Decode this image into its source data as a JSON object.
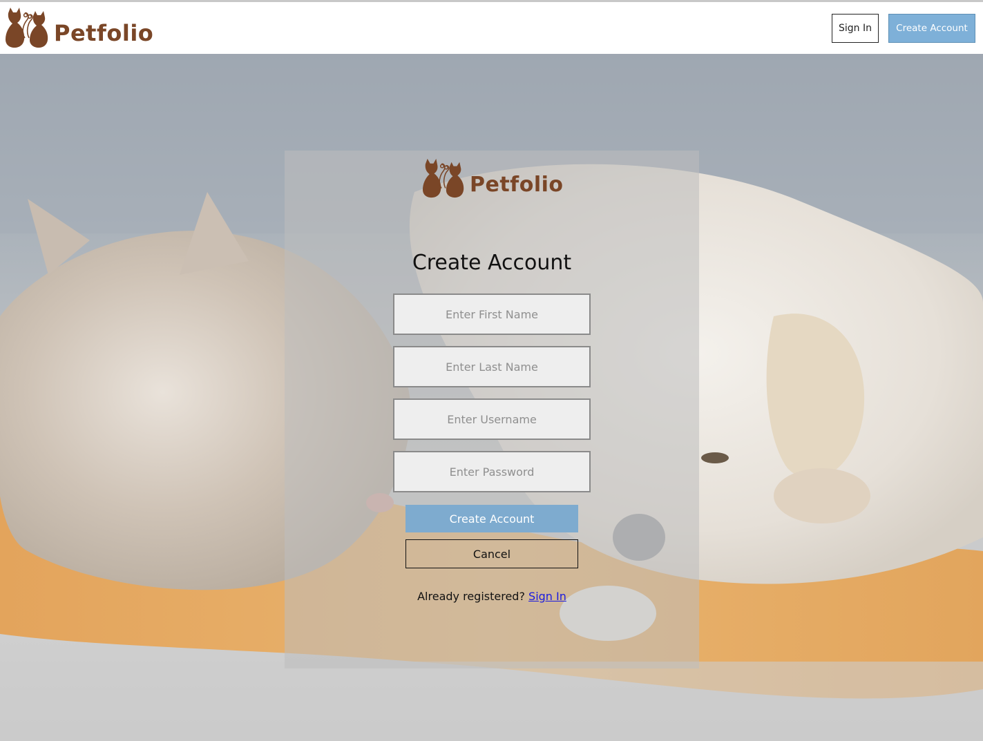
{
  "brand": {
    "name": "Petfolio",
    "color": "#7a4627"
  },
  "header": {
    "sign_in_label": "Sign In",
    "create_account_label": "Create Account",
    "create_account_color": "#7eb0d8"
  },
  "form": {
    "title": "Create Account",
    "first_name_placeholder": "Enter First Name",
    "last_name_placeholder": "Enter Last Name",
    "username_placeholder": "Enter Username",
    "password_placeholder": "Enter Password",
    "submit_label": "Create Account",
    "cancel_label": "Cancel",
    "already_text": "Already registered?",
    "sign_in_link": "Sign In"
  },
  "icons": {
    "logo": "two-cats-silhouette-icon"
  }
}
